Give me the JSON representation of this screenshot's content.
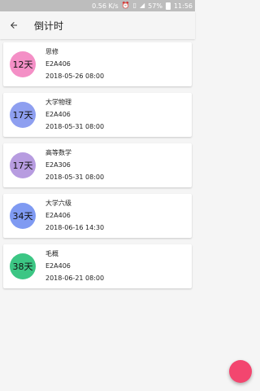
{
  "status_bar": {
    "speed": "0.56 K/s",
    "battery": "57%",
    "time": "11:56"
  },
  "app_bar": {
    "title": "倒计时"
  },
  "items": [
    {
      "days": "12天",
      "color": "#f48fc6",
      "name": "思修",
      "room": "E2A406",
      "datetime": "2018-05-26 08:00"
    },
    {
      "days": "17天",
      "color": "#8e9ff0",
      "name": "大学物理",
      "room": "E2A406",
      "datetime": "2018-05-31 08:00"
    },
    {
      "days": "17天",
      "color": "#b79ce0",
      "name": "高等数学",
      "room": "E2A306",
      "datetime": "2018-05-31 08:00"
    },
    {
      "days": "34天",
      "color": "#7f9af2",
      "name": "大学六级",
      "room": "E2A406",
      "datetime": "2018-06-16 14:30"
    },
    {
      "days": "38天",
      "color": "#3cc684",
      "name": "毛概",
      "room": "E2A406",
      "datetime": "2018-06-21 08:00"
    }
  ],
  "fab": {
    "color": "#f3466f"
  }
}
